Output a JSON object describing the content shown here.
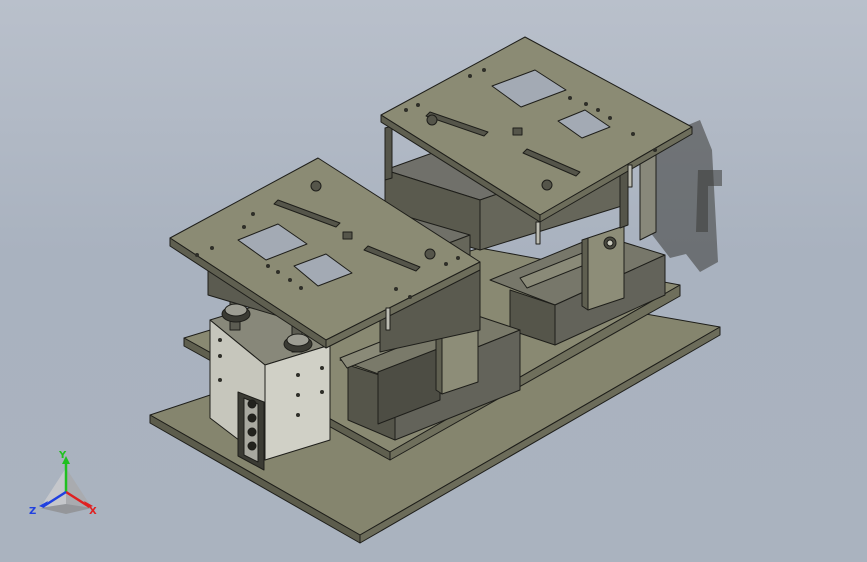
{
  "viewport": {
    "background_top": "#b9c0cb",
    "background_bottom": "#aab3bf"
  },
  "model": {
    "base_color": "#83836c",
    "plate_color": "#7f7f68",
    "block_color": "#5f5f51",
    "edge_color": "#1e1e1a"
  },
  "triad": {
    "x_label": "X",
    "y_label": "Y",
    "z_label": "Z",
    "x_color": "#e02020",
    "y_color": "#20c020",
    "z_color": "#2040e0"
  }
}
